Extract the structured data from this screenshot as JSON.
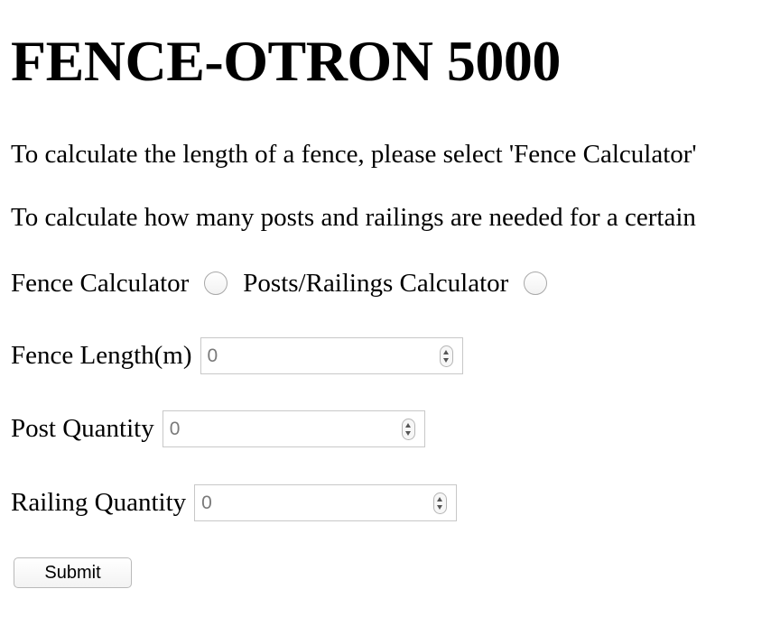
{
  "page": {
    "title": "FENCE-OTRON 5000",
    "instructions": [
      "To calculate the length of a fence, please select 'Fence Calculator'",
      "To calculate how many posts and railings are needed for a certain"
    ]
  },
  "mode_selector": {
    "options": [
      {
        "label": "Fence Calculator",
        "checked": false
      },
      {
        "label": "Posts/Railings Calculator",
        "checked": false
      }
    ]
  },
  "fields": {
    "fence_length": {
      "label": "Fence Length(m)",
      "value": "0"
    },
    "post_quantity": {
      "label": "Post Quantity",
      "value": "0"
    },
    "railing_quantity": {
      "label": "Railing Quantity",
      "value": "0"
    }
  },
  "actions": {
    "submit_label": "Submit"
  }
}
